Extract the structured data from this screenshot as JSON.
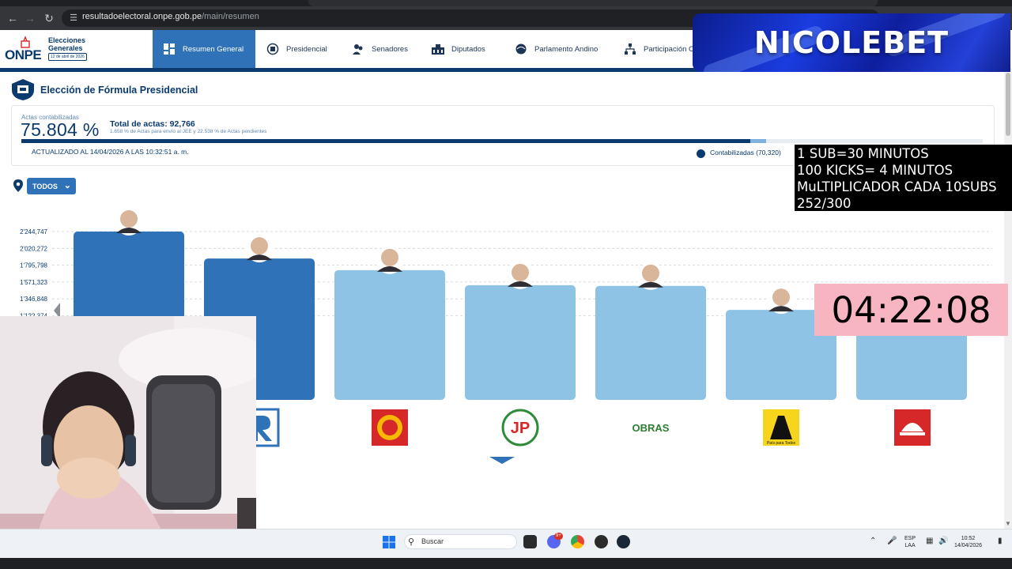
{
  "browser": {
    "url_host": "resultadoelectoral.onpe.gob.pe",
    "url_path": "/main/resumen"
  },
  "site": {
    "logo_text": "ONPE",
    "election_title": "Elecciones Generales",
    "election_date": "12 de abril de 2026",
    "menu": [
      {
        "label": "Resumen General",
        "icon": "grid-icon",
        "active": true
      },
      {
        "label": "Presidencial",
        "icon": "seal-icon",
        "active": false
      },
      {
        "label": "Senadores",
        "icon": "people-icon",
        "active": false
      },
      {
        "label": "Diputados",
        "icon": "building-icon",
        "active": false
      },
      {
        "label": "Parlamento Andino",
        "icon": "globe-icon",
        "active": false
      },
      {
        "label": "Participación C",
        "icon": "network-icon",
        "active": false
      }
    ]
  },
  "page": {
    "title": "Elección de Fórmula Presidencial",
    "actas_label": "Actas contabilizadas",
    "actas_pct": "75.804 %",
    "actas_fraction": 0.75804,
    "jee_fraction": 0.01658,
    "total_actas": "Total de actas: 92,766",
    "actas_sub": "1.658 % de Actas para envío al JEE y 22.538 % de Actas pendientes",
    "updated": "ACTUALIZADO AL 14/04/2026 A LAS 10:32:51 a. m.",
    "legend": "Contabilizadas (70,320)",
    "filter": "TODOS"
  },
  "chart_data": {
    "type": "bar",
    "y_ticks": [
      "2'244,747",
      "2'020,272",
      "1'795,798",
      "1'571,323",
      "1'346,848",
      "1'122,374"
    ],
    "ylim": [
      0,
      2244747
    ],
    "values": [
      2244747,
      1885000,
      1730000,
      1530000,
      1520000,
      1200000,
      1200000
    ],
    "highlight": [
      true,
      true,
      false,
      false,
      false,
      false,
      false
    ],
    "logos": [
      "letter-r-logo",
      "sun-logo",
      "jp-logo",
      "obras-logo",
      "road-logo",
      "helmet-logo"
    ],
    "logo_texts": [
      "",
      "",
      "JP",
      "OBRAS",
      "País para Todos",
      ""
    ],
    "colors": {
      "dark": "#2f72b8",
      "light": "#8ec3e6"
    }
  },
  "overlays": {
    "brand": "NICOLEBET",
    "subs_lines": [
      "1 SUB=30 MINUTOS",
      "100 KICKS= 4 MINUTOS",
      "MuLTIPLICADOR CADA 10SUBS",
      "252/300"
    ],
    "timer": "04:22:08"
  },
  "taskbar": {
    "search": "Buscar",
    "lang_top": "ESP",
    "lang_bottom": "LAA",
    "time": "10:52",
    "date": "14/04/2026",
    "badge_a": "9+"
  }
}
